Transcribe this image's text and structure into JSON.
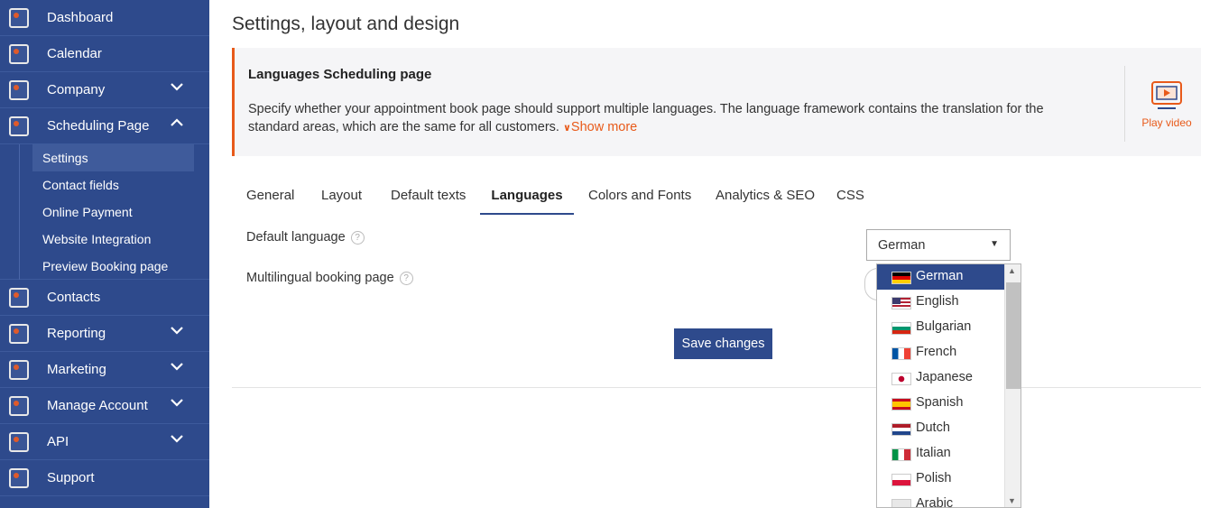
{
  "sidebar": {
    "dashboard": "Dashboard",
    "calendar": "Calendar",
    "company": "Company",
    "scheduling_page": "Scheduling Page",
    "sub": [
      "Settings",
      "Contact fields",
      "Online Payment",
      "Website Integration",
      "Preview Booking page"
    ],
    "contacts": "Contacts",
    "reporting": "Reporting",
    "marketing": "Marketing",
    "manage_account": "Manage Account",
    "api": "API",
    "support": "Support"
  },
  "main": {
    "title": "Settings, layout and design",
    "info": {
      "title": "Languages Scheduling page",
      "text": "Specify whether your appointment book page should support multiple languages. The language framework contains the translation for the standard areas, which are the same for all customers.",
      "show_more": "Show more",
      "video_label": "Play video"
    },
    "tabs": [
      "General",
      "Layout",
      "Default texts",
      "Languages",
      "Colors and Fonts",
      "Analytics & SEO",
      "CSS"
    ],
    "active_tab": "Languages",
    "default_language_label": "Default language",
    "multilingual_label": "Multilingual booking page",
    "help": "?",
    "select_value": "German",
    "save_label": "Save changes",
    "dropdown_options": [
      "German",
      "English",
      "Bulgarian",
      "French",
      "Japanese",
      "Spanish",
      "Dutch",
      "Italian",
      "Polish",
      "Arabic"
    ]
  },
  "colors": {
    "sidebar": "#2e4a8c",
    "accent": "#e85a1a",
    "selected": "#2e4a8c"
  }
}
